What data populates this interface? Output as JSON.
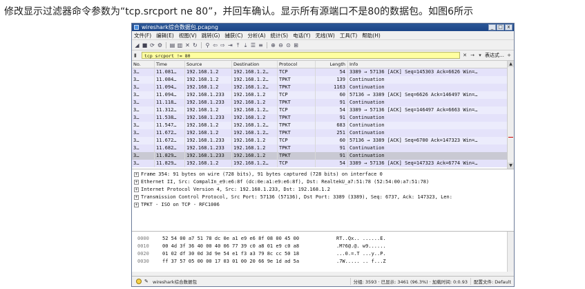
{
  "caption": "修改显示过滤器命令参数为“tcp.srcport ne 80”，并回车确认。显示所有源端口不是80的数据包。如图6所示",
  "window": {
    "title": "wireshark综合数据包.pcapng",
    "controls": [
      "_",
      "□",
      "x"
    ]
  },
  "menu": [
    "文件(F)",
    "编辑(E)",
    "视图(V)",
    "跳转(G)",
    "捕获(C)",
    "分析(A)",
    "统计(S)",
    "电话(Y)",
    "无线(W)",
    "工具(T)",
    "帮助(H)"
  ],
  "toolbar_icons": [
    "shark-fin-icon",
    "stop-icon",
    "restart-icon",
    "options-icon",
    "open-icon",
    "save-icon",
    "close-file-icon",
    "reload-icon",
    "find-icon",
    "back-icon",
    "forward-icon",
    "goto-icon",
    "first-icon",
    "last-icon",
    "autoscroll-icon",
    "colorize-icon",
    "zoom-in-icon",
    "zoom-out-icon",
    "zoom-reset-icon",
    "resize-columns-icon"
  ],
  "filter": {
    "value": "tcp srcport != 80",
    "expression_label": "表达式…",
    "plus": "+"
  },
  "packet_list": {
    "columns": [
      "No.",
      "Time",
      "Source",
      "Destination",
      "Protocol",
      "Length",
      "Info"
    ],
    "rows": [
      {
        "no": "3…",
        "time": "11.081…",
        "src": "192.168.1.2",
        "dst": "192.168.1.2…",
        "proto": "TCP",
        "len": "54",
        "info": "3389 → 57136 [ACK] Seq=145303 Ack=6626 Win=…"
      },
      {
        "no": "3…",
        "time": "11.084…",
        "src": "192.168.1.2",
        "dst": "192.168.1.2…",
        "proto": "TPKT",
        "len": "139",
        "info": "Continuation"
      },
      {
        "no": "3…",
        "time": "11.094…",
        "src": "192.168.1.2",
        "dst": "192.168.1.2…",
        "proto": "TPKT",
        "len": "1163",
        "info": "Continuation"
      },
      {
        "no": "3…",
        "time": "11.094…",
        "src": "192.168.1.233",
        "dst": "192.168.1.2",
        "proto": "TCP",
        "len": "60",
        "info": "57136 → 3389 [ACK] Seq=6626 Ack=146497 Win=…"
      },
      {
        "no": "3…",
        "time": "11.118…",
        "src": "192.168.1.233",
        "dst": "192.168.1.2",
        "proto": "TPKT",
        "len": "91",
        "info": "Continuation"
      },
      {
        "no": "3…",
        "time": "11.312…",
        "src": "192.168.1.2",
        "dst": "192.168.1.2…",
        "proto": "TCP",
        "len": "54",
        "info": "3389 → 57136 [ACK] Seq=146497 Ack=6663 Win=…"
      },
      {
        "no": "3…",
        "time": "11.538…",
        "src": "192.168.1.233",
        "dst": "192.168.1.2",
        "proto": "TPKT",
        "len": "91",
        "info": "Continuation"
      },
      {
        "no": "3…",
        "time": "11.547…",
        "src": "192.168.1.2",
        "dst": "192.168.1.2…",
        "proto": "TPKT",
        "len": "683",
        "info": "Continuation"
      },
      {
        "no": "3…",
        "time": "11.672…",
        "src": "192.168.1.2",
        "dst": "192.168.1.2…",
        "proto": "TPKT",
        "len": "251",
        "info": "Continuation"
      },
      {
        "no": "3…",
        "time": "11.672…",
        "src": "192.168.1.233",
        "dst": "192.168.1.2",
        "proto": "TCP",
        "len": "60",
        "info": "57136 → 3389 [ACK] Seq=6700 Ack=147323 Win=…"
      },
      {
        "no": "3…",
        "time": "11.682…",
        "src": "192.168.1.233",
        "dst": "192.168.1.2",
        "proto": "TPKT",
        "len": "91",
        "info": "Continuation"
      },
      {
        "no": "3…",
        "time": "11.829…",
        "src": "192.168.1.233",
        "dst": "192.168.1.2",
        "proto": "TPKT",
        "len": "91",
        "info": "Continuation",
        "selected": true
      },
      {
        "no": "3…",
        "time": "11.829…",
        "src": "192.168.1.2",
        "dst": "192.168.1.2…",
        "proto": "TCP",
        "len": "54",
        "info": "3389 → 57136 [ACK] Seq=147323 Ack=6774 Win=…"
      }
    ]
  },
  "details": [
    "Frame 354: 91 bytes on wire (728 bits), 91 bytes captured (728 bits) on interface 0",
    "Ethernet II, Src: CompalIn_e9:e6:8f (dc:0e:a1:e9:e6:8f), Dst: RealtekU_a7:51:78 (52:54:00:a7:51:78)",
    "Internet Protocol Version 4, Src: 192.168.1.233, Dst: 192.168.1.2",
    "Transmission Control Protocol, Src Port: 57136 (57136), Dst Port: 3389 (3389), Seq: 6737, Ack: 147323, Len:",
    "TPKT - ISO on TCP - RFC1006"
  ],
  "hex": [
    {
      "offset": "0000",
      "bytes": "52 54 00 a7 51 78 dc 0e  a1 e9 e6 8f 08 00 45 00",
      "ascii": "RT..Qx.. ......E."
    },
    {
      "offset": "0010",
      "bytes": "00 4d 3f 36 40 00 40 06  77 39 c0 a8 01 e9 c0 a8",
      "ascii": ".M?6@.@. w9......"
    },
    {
      "offset": "0020",
      "bytes": "01 02 df 30 0d 3d 9e 54  e1 f3 a3 79 8c cc 50 18",
      "ascii": "...0.=.T ...y..P."
    },
    {
      "offset": "0030",
      "bytes": "ff 37 57 05 00 00 17 03  01 00 20 66 9e 1d ad 5a",
      "ascii": ".7W..... .. f...Z"
    }
  ],
  "status": {
    "file": "wireshark综合数据包",
    "stats": "分组: 3593 · 已显示: 3461 (96.3%) · 加载时间: 0:0.93",
    "profile": "配置文件: Default"
  }
}
